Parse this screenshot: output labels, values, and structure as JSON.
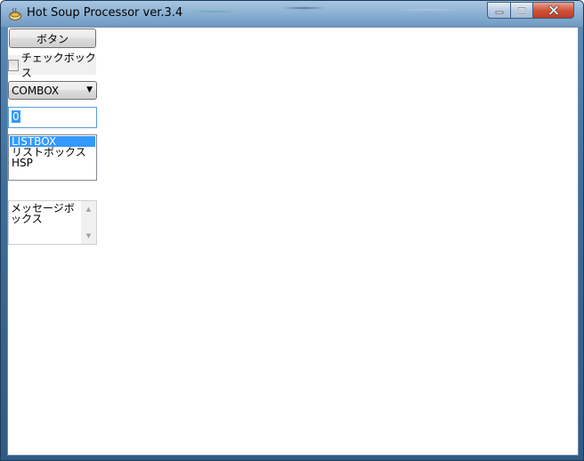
{
  "window": {
    "title": "Hot Soup Processor ver.3.4",
    "icon": "hsp-app-icon",
    "colors": {
      "titlebar": "#8db2d4",
      "close_button": "#c23a22",
      "selection": "#3399ff"
    }
  },
  "controls": {
    "button_label": "ボタン",
    "checkbox_label": "チェックボックス",
    "checkbox_checked": false,
    "combo_value": "COMBOX",
    "input_value": "0",
    "listbox_items": [
      "LISTBOX",
      "リストボックス",
      "HSP"
    ],
    "listbox_selected": 0,
    "messagebox_text": "メッセージボックス"
  },
  "icons": {
    "minimize": "minimize-icon",
    "maximize": "maximize-icon",
    "close": "close-icon",
    "combo_arrow": "chevron-down-icon",
    "scroll_up": "scroll-up-icon",
    "scroll_down": "scroll-down-icon"
  }
}
